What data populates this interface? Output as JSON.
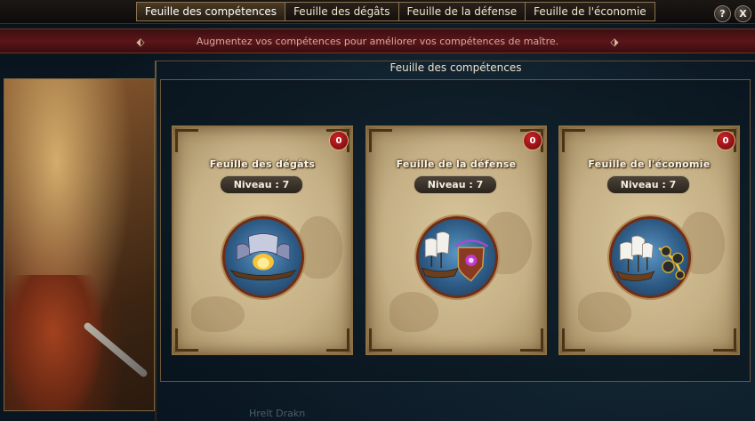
{
  "tabs": [
    {
      "label": "Feuille des compétences",
      "active": true
    },
    {
      "label": "Feuille des dégâts",
      "active": false
    },
    {
      "label": "Feuille de la défense",
      "active": false
    },
    {
      "label": "Feuille de l'économie",
      "active": false
    }
  ],
  "buttons": {
    "help": "?",
    "close": "X"
  },
  "banner": {
    "text": "Augmentez vos compétences pour améliorer vos compétences de maître."
  },
  "section_title": "Feuille des compétences",
  "cards": [
    {
      "title": "Feuille des dégâts",
      "level": "Niveau : 7",
      "badge": "0",
      "emblem": "warships-sails-icon"
    },
    {
      "title": "Feuille de la défense",
      "level": "Niveau : 7",
      "badge": "0",
      "emblem": "ship-shield-icon"
    },
    {
      "title": "Feuille de l'économie",
      "level": "Niveau : 7",
      "badge": "0",
      "emblem": "ship-cannonballs-icon"
    }
  ],
  "background_label": "Hrelt Drakn"
}
